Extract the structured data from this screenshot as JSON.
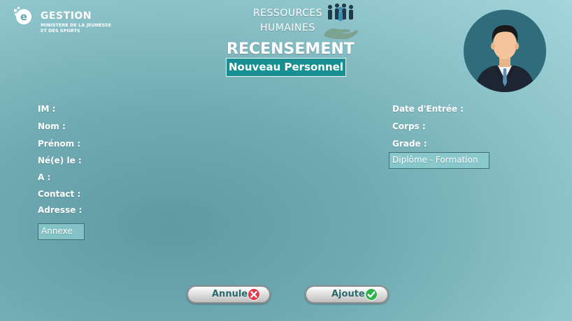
{
  "brand": {
    "logo_title": "GESTION",
    "logo_sub_line1": "MINISTERE DE LA JEUNESSE",
    "logo_sub_line2": "ET DES SPORTS"
  },
  "header": {
    "line1": "RESSOURCES",
    "line2": "HUMAINES",
    "title": "RECENSEMENT",
    "subtitle": "Nouveau Personnel"
  },
  "left_fields": [
    "IM :",
    "Nom :",
    "Prénom :",
    "Né(e) le :",
    "A :",
    "Contact :",
    "Adresse :"
  ],
  "right_fields": [
    "Date d'Entrée :",
    "Corps :",
    "Grade :"
  ],
  "buttons": {
    "diplome": "Diplôme - Formation",
    "annexe": "Annexe",
    "cancel": "Annuler",
    "add": "Ajouter"
  },
  "colors": {
    "accent": "#178f93",
    "cancel_icon": "#e0394b",
    "add_icon": "#2fb24a"
  }
}
